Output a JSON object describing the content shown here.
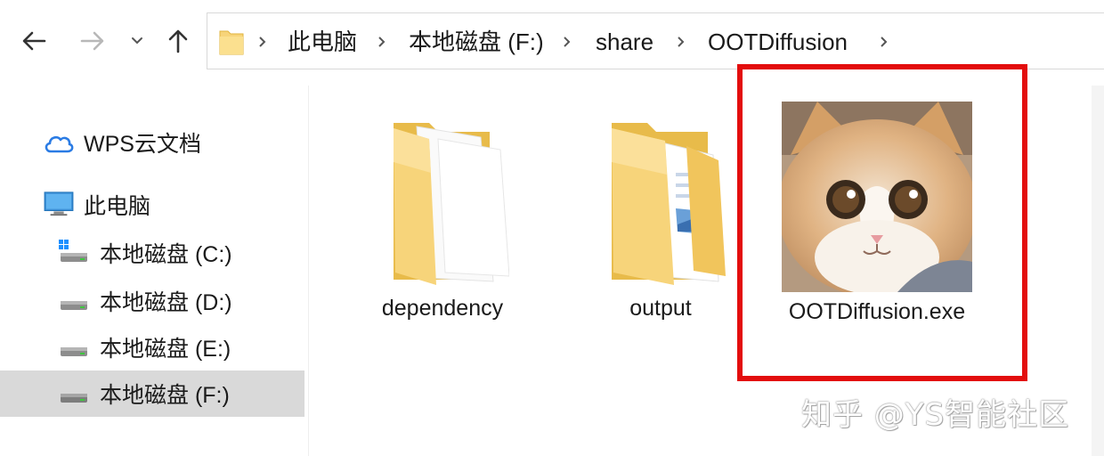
{
  "nav": {
    "back_icon": "arrow-left-icon",
    "forward_icon": "arrow-right-icon",
    "recent_icon": "chevron-down-icon",
    "up_icon": "arrow-up-icon"
  },
  "address_bar": {
    "breadcrumbs": [
      "此电脑",
      "本地磁盘 (F:)",
      "share",
      "OOTDiffusion"
    ]
  },
  "sidebar": {
    "items": [
      {
        "label": "WPS云文档",
        "icon": "cloud-icon"
      },
      {
        "label": "此电脑",
        "icon": "computer-icon"
      },
      {
        "label": "本地磁盘 (C:)",
        "icon": "system-drive-icon"
      },
      {
        "label": "本地磁盘 (D:)",
        "icon": "drive-icon"
      },
      {
        "label": "本地磁盘 (E:)",
        "icon": "drive-icon"
      },
      {
        "label": "本地磁盘 (F:)",
        "icon": "drive-icon",
        "selected": true
      }
    ]
  },
  "files": [
    {
      "name": "dependency",
      "type": "folder"
    },
    {
      "name": "output",
      "type": "folder"
    },
    {
      "name": "OOTDiffusion.exe",
      "type": "executable",
      "icon": "cat-photo-icon",
      "highlighted": true
    }
  ],
  "watermark": "知乎 @YS智能社区",
  "colors": {
    "highlight_border": "#e30d0d",
    "selected_bg": "#d9d9d9",
    "folder_yellow": "#f7d47a"
  }
}
